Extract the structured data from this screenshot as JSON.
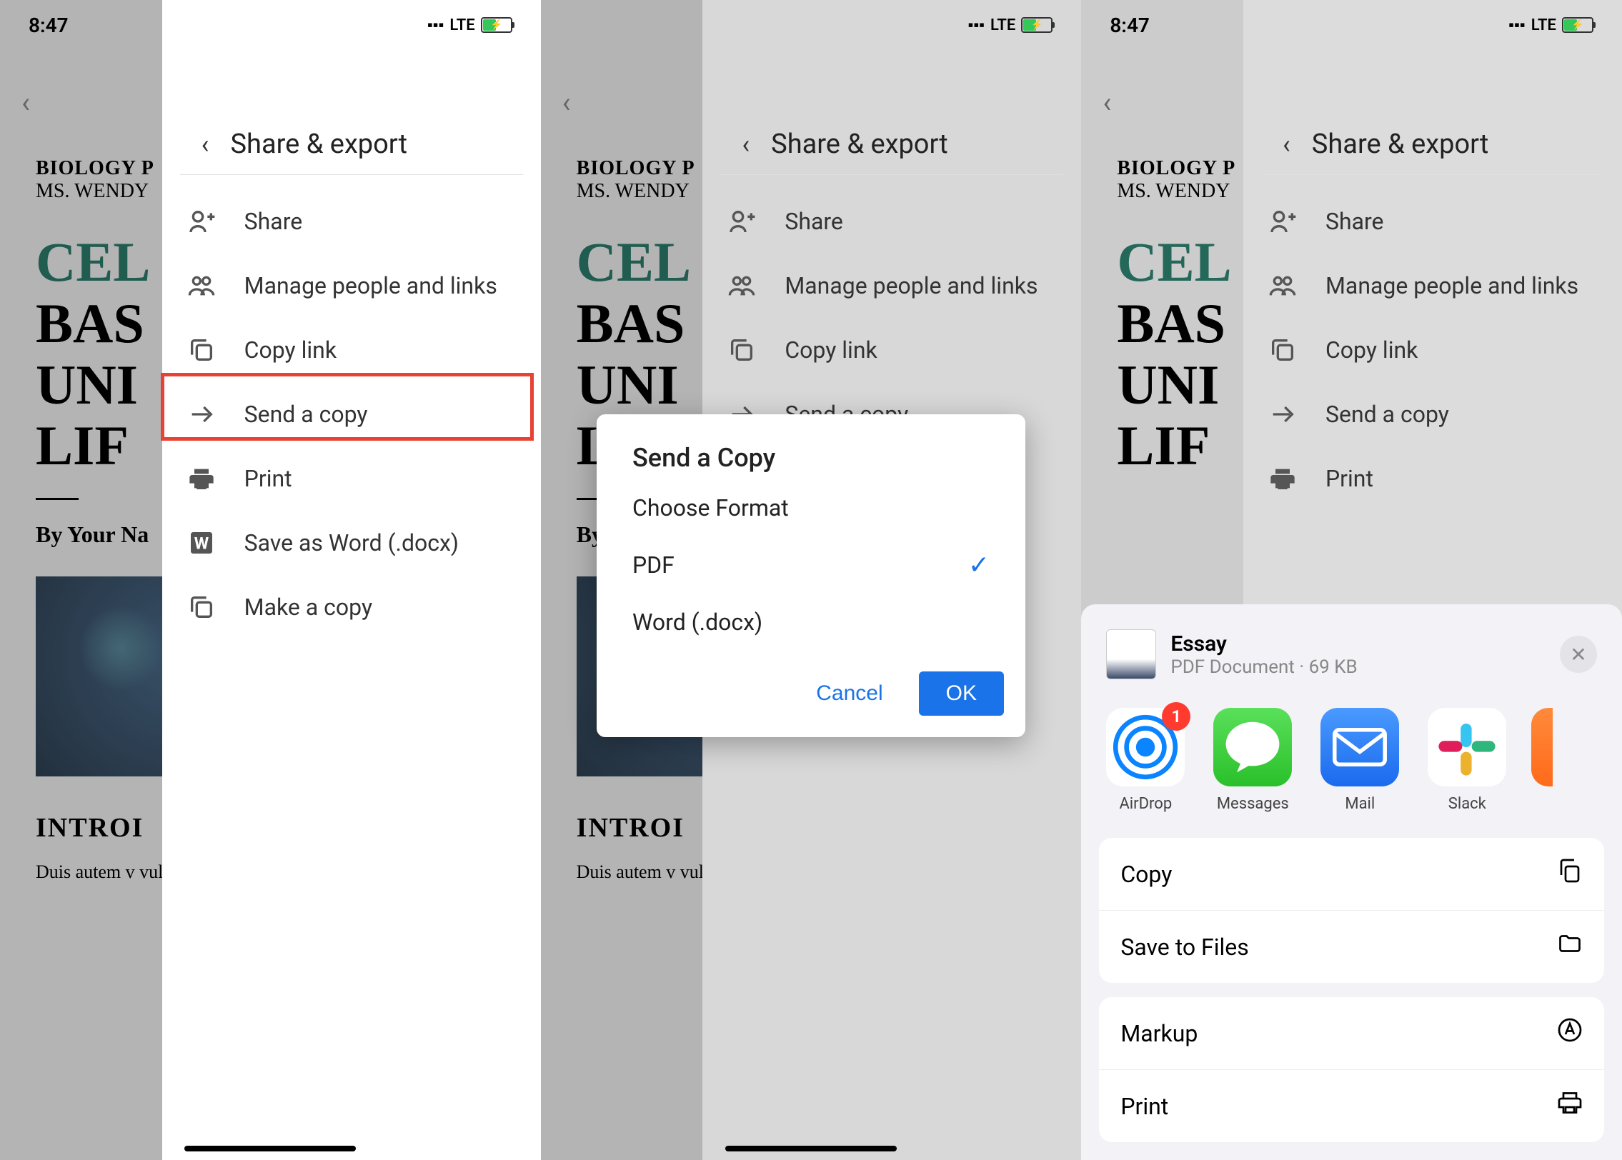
{
  "status": {
    "time": "8:47",
    "network": "LTE"
  },
  "document": {
    "header1": "BIOLOGY",
    "header1_rest": " P",
    "header2": "MS. WENDY",
    "title_colored": "CEL",
    "title_line1": "BAS",
    "title_line2": "UNI",
    "title_line3": "LIF",
    "byline": "By Your Na",
    "intro_heading": "INTROI",
    "body_text": "Duis autem v\nvulputate vel\ndolore eu feu\naccumsan."
  },
  "panel": {
    "title": "Share & export",
    "items": [
      {
        "icon": "person-add",
        "label": "Share"
      },
      {
        "icon": "people",
        "label": "Manage people and links"
      },
      {
        "icon": "copy-link",
        "label": "Copy link"
      },
      {
        "icon": "send",
        "label": "Send a copy"
      },
      {
        "icon": "print",
        "label": "Print"
      },
      {
        "icon": "word",
        "label": "Save as Word (.docx)"
      },
      {
        "icon": "duplicate",
        "label": "Make a copy"
      }
    ]
  },
  "panel_short": {
    "items": [
      {
        "icon": "person-add",
        "label": "Share"
      },
      {
        "icon": "people",
        "label": "Manage people and links"
      },
      {
        "icon": "copy-link",
        "label": "Copy link"
      },
      {
        "icon": "send",
        "label": "Send a copy"
      },
      {
        "icon": "print",
        "label": "Print"
      }
    ]
  },
  "dialog": {
    "title": "Send a Copy",
    "subtitle": "Choose Format",
    "options": [
      {
        "label": "PDF",
        "selected": true
      },
      {
        "label": "Word (.docx)",
        "selected": false
      }
    ],
    "cancel": "Cancel",
    "ok": "OK"
  },
  "share_sheet": {
    "file_title": "Essay",
    "file_subtitle": "PDF Document · 69 KB",
    "apps": [
      {
        "name": "AirDrop",
        "badge": "1"
      },
      {
        "name": "Messages"
      },
      {
        "name": "Mail"
      },
      {
        "name": "Slack"
      }
    ],
    "actions_group1": [
      {
        "label": "Copy",
        "icon": "copy"
      },
      {
        "label": "Save to Files",
        "icon": "folder"
      }
    ],
    "actions_group2": [
      {
        "label": "Markup",
        "icon": "markup"
      },
      {
        "label": "Print",
        "icon": "printer"
      }
    ]
  }
}
